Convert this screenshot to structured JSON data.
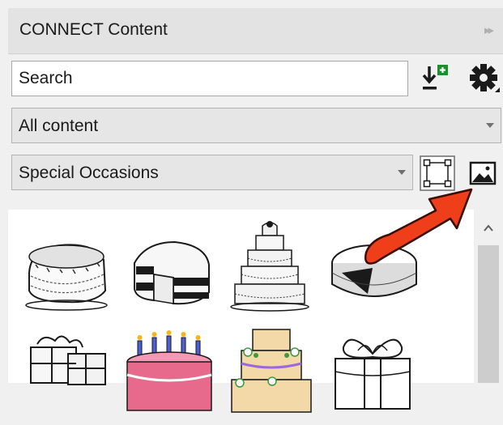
{
  "panel": {
    "title": "CONNECT Content",
    "collapse_icon": "double-chevron-right-icon"
  },
  "search": {
    "placeholder": "Search",
    "value": ""
  },
  "toolbar": {
    "download_icon": "download-plus-icon",
    "settings_icon": "gear-icon"
  },
  "filters": {
    "source_value": "All content",
    "category_value": "Special Occasions"
  },
  "view_buttons": {
    "frame_icon": "frame-select-icon",
    "image_icon": "image-icon"
  },
  "gallery": {
    "items": [
      {
        "icon": "cake-sketch-icon"
      },
      {
        "icon": "sliced-cake-icon"
      },
      {
        "icon": "wedding-cake-icon"
      },
      {
        "icon": "cheesecake-icon"
      },
      {
        "icon": "gift-boxes-icon"
      },
      {
        "icon": "birthday-cake-candles-icon"
      },
      {
        "icon": "floral-tiered-cake-icon"
      },
      {
        "icon": "gift-bow-icon"
      }
    ]
  },
  "colors": {
    "accent_arrow": "#ef3e1a",
    "pink_cake": "#e7698c",
    "cream_cake": "#f3d9a7"
  }
}
